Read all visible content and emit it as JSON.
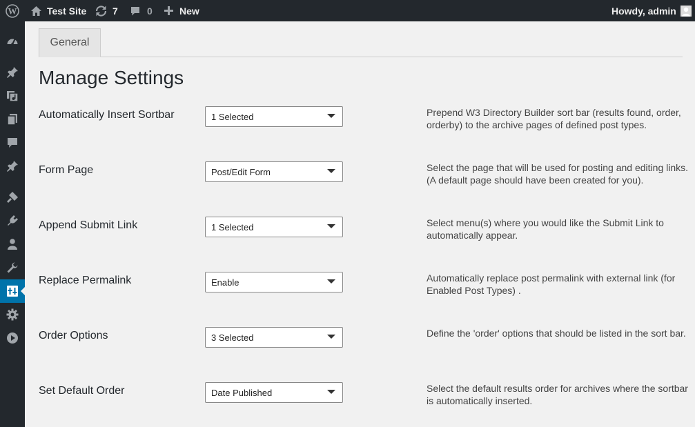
{
  "adminbar": {
    "site_name": "Test Site",
    "updates_count": "7",
    "comments_count": "0",
    "new_label": "New",
    "howdy": "Howdy, admin"
  },
  "sidebar": {
    "items": [
      {
        "icon": "dashboard-icon"
      },
      {
        "icon": "posts-icon"
      },
      {
        "icon": "media-icon"
      },
      {
        "icon": "pages-icon"
      },
      {
        "icon": "comments-icon"
      },
      {
        "icon": "pin-icon"
      },
      {
        "icon": "appearance-icon"
      },
      {
        "icon": "plugins-icon"
      },
      {
        "icon": "users-icon"
      },
      {
        "icon": "tools-icon"
      },
      {
        "icon": "directory-builder-icon",
        "current": true
      },
      {
        "icon": "settings-icon"
      },
      {
        "icon": "play-icon"
      }
    ]
  },
  "tabs": [
    {
      "label": "General"
    }
  ],
  "page_title": "Manage Settings",
  "settings": [
    {
      "label": "Automatically Insert Sortbar",
      "value": "1 Selected",
      "desc": "Prepend W3 Directory Builder sort bar (results found, order, orderby) to the archive pages of defined post types."
    },
    {
      "label": "Form Page",
      "value": "Post/Edit Form",
      "desc": "Select the page that will be used for posting and editing links. (A default page should have been created for you)."
    },
    {
      "label": "Append Submit Link",
      "value": "1 Selected",
      "desc": "Select menu(s) where you would like the Submit Link to automatically appear."
    },
    {
      "label": "Replace Permalink",
      "value": "Enable",
      "desc": "Automatically replace post permalink with external link (for Enabled Post Types) ."
    },
    {
      "label": "Order Options",
      "value": "3 Selected",
      "desc": "Define the 'order' options that should be listed in the sort bar."
    },
    {
      "label": "Set Default Order",
      "value": "Date Published",
      "desc": "Select the default results order for archives where the sortbar is automatically inserted."
    }
  ],
  "colors": {
    "adminbar_bg": "#23282d",
    "menu_current": "#0073aa",
    "content_bg": "#f1f1f1"
  }
}
